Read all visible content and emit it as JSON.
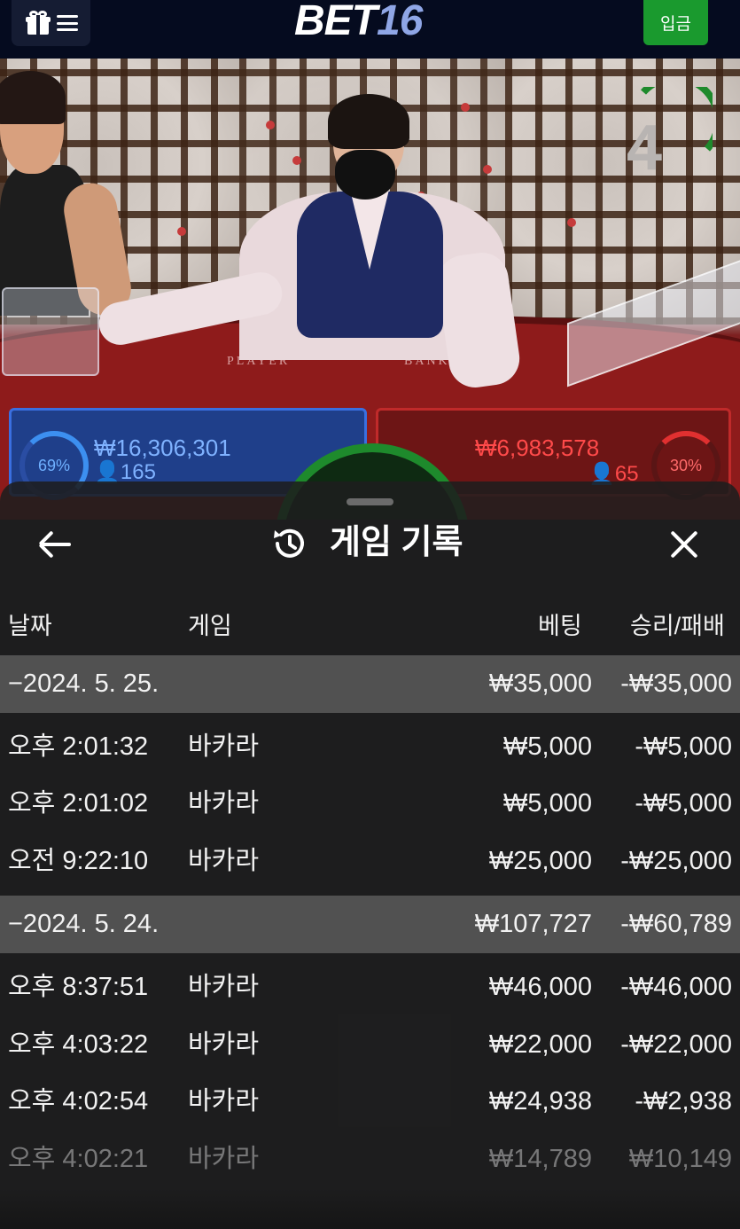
{
  "header": {
    "logo_main": "BET",
    "logo_num": "16",
    "deposit_label": "입금"
  },
  "scene": {
    "countdown": "4",
    "table_label_player": "PLAYER",
    "table_label_banker": "BANKER",
    "player_pct": "69%",
    "player_amount": "₩16,306,301",
    "player_count": "165",
    "banker_pct": "30%",
    "banker_amount": "₩6,983,578",
    "banker_count": "65",
    "colors": {
      "player": "#1f3f8a",
      "banker": "#6d1515",
      "timer": "#1e8a2c"
    }
  },
  "sheet": {
    "title": "게임 기록",
    "columns": {
      "date": "날짜",
      "game": "게임",
      "bet": "베팅",
      "result": "승리/패배"
    },
    "rows": [
      {
        "type": "group",
        "date": "−2024. 5. 25.",
        "game": "",
        "bet": "₩35,000",
        "result": "-₩35,000"
      },
      {
        "type": "item",
        "date": "오후 2:01:32",
        "game": "바카라",
        "bet": "₩5,000",
        "result": "-₩5,000"
      },
      {
        "type": "item",
        "date": "오후 2:01:02",
        "game": "바카라",
        "bet": "₩5,000",
        "result": "-₩5,000"
      },
      {
        "type": "item",
        "date": "오전 9:22:10",
        "game": "바카라",
        "bet": "₩25,000",
        "result": "-₩25,000"
      },
      {
        "type": "group",
        "date": "−2024. 5. 24.",
        "game": "",
        "bet": "₩107,727",
        "result": "-₩60,789"
      },
      {
        "type": "item",
        "date": "오후 8:37:51",
        "game": "바카라",
        "bet": "₩46,000",
        "result": "-₩46,000"
      },
      {
        "type": "item",
        "date": "오후 4:03:22",
        "game": "바카라",
        "bet": "₩22,000",
        "result": "-₩22,000"
      },
      {
        "type": "item",
        "date": "오후 4:02:54",
        "game": "바카라",
        "bet": "₩24,938",
        "result": "-₩2,938"
      },
      {
        "type": "item",
        "date": "오후 4:02:21",
        "game": "바카라",
        "bet": "₩14,789",
        "result": "₩10,149"
      }
    ]
  }
}
